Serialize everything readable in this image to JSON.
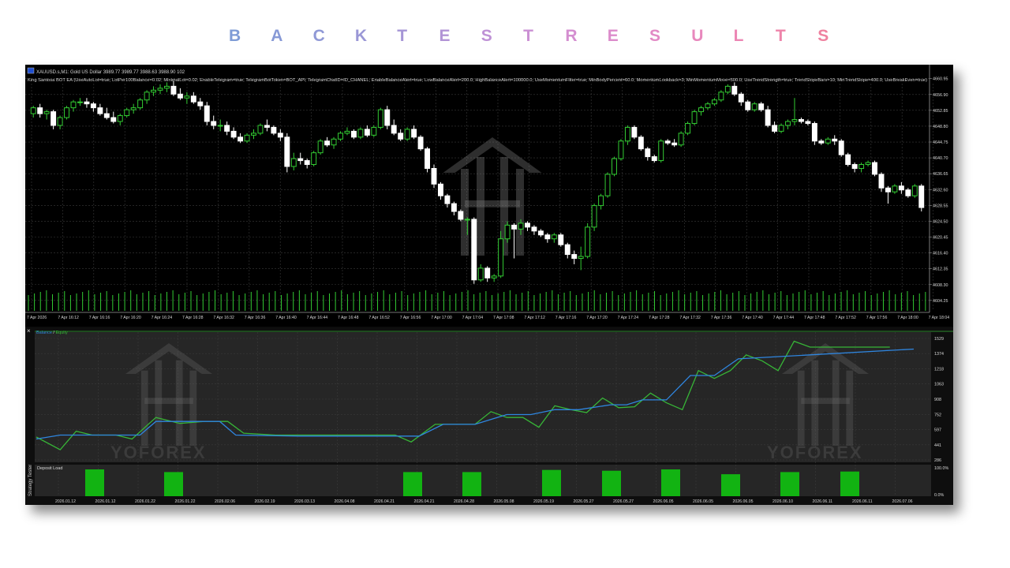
{
  "header": {
    "title_letters": [
      "B",
      "A",
      "C",
      "K",
      "T",
      "E",
      "S",
      "T",
      "R",
      "E",
      "S",
      "U",
      "L",
      "T",
      "S"
    ],
    "title_colors": [
      "#7f9cd6",
      "#8799d6",
      "#9099d6",
      "#9a97d6",
      "#a595d6",
      "#b294d6",
      "#bf92d6",
      "#cb90d4",
      "#d48ed0",
      "#dc8ccb",
      "#e28ac5",
      "#e888bd",
      "#ec86b4",
      "#ee84aa",
      "#ef82a0"
    ]
  },
  "price_chart": {
    "symbol_line": "XAUUSD.s,M1:  Gold US Dollar  3989.77 3989.77 3988.63 3988.90  102",
    "ea_params": "King Santosa BOT EA (UseAutoLot=true; LotPer100Balance=0.02; MinimalLot=0.02; EnableTelegram=true; TelegramBotToken=BOT_API; TelegramChatID=ID_CHANEL; EnableBalanceAlert=true; LowBalanceAlert=200.0; HighBalanceAlert=100000.0; UseMomentumFilter=true; MinBodyPercent=60.0; MomentumLookback=3; MinMomentumMove=500.0; UseTrendStrength=true; TrendSlopeBars=10; MinTrendSlope=400.0; UseBreakEven=true)",
    "price_axis": [
      "4660.95",
      "4656.90",
      "4652.85",
      "4648.80",
      "4644.75",
      "4640.70",
      "4636.65",
      "4632.60",
      "4628.55",
      "4624.50",
      "4620.45",
      "4616.40",
      "4612.35",
      "4608.30",
      "4604.25"
    ],
    "time_axis": [
      "7 Apr 2026",
      "7 Apr 16:12",
      "7 Apr 16:16",
      "7 Apr 16:20",
      "7 Apr 16:24",
      "7 Apr 16:28",
      "7 Apr 16:32",
      "7 Apr 16:36",
      "7 Apr 16:40",
      "7 Apr 16:44",
      "7 Apr 16:48",
      "7 Apr 16:52",
      "7 Apr 16:56",
      "7 Apr 17:00",
      "7 Apr 17:04",
      "7 Apr 17:08",
      "7 Apr 17:12",
      "7 Apr 17:16",
      "7 Apr 17:20",
      "7 Apr 17:24",
      "7 Apr 17:28",
      "7 Apr 17:32",
      "7 Apr 17:36",
      "7 Apr 17:40",
      "7 Apr 17:44",
      "7 Apr 17:48",
      "7 Apr 17:52",
      "7 Apr 17:56",
      "7 Apr 18:00",
      "7 Apr 18:04"
    ],
    "watermark": "yoforex-logo"
  },
  "tester": {
    "close_glyph": "×",
    "legend_balance": "Balance",
    "legend_sep": " / ",
    "legend_equity": "Equity",
    "side_label": "Strategy Tester",
    "deposit_label": "Deposit Load",
    "watermark_text": "YOFOREX",
    "deposit_axis": [
      "100.0%",
      "0.0%"
    ],
    "date_axis": [
      "2026.01.12",
      "2026.01.12",
      "2026.01.22",
      "2026.01.22",
      "2026.02.06",
      "2026.02.19",
      "2026.03.13",
      "2026.04.08",
      "2026.04.21",
      "2026.04.21",
      "2026.04.28",
      "2026.05.08",
      "2026.05.19",
      "2026.05.27",
      "2026.05.27",
      "2026.06.05",
      "2026.06.05",
      "2026.06.05",
      "2026.06.10",
      "2026.06.11",
      "2026.06.11",
      "2026.07.06"
    ]
  },
  "colors": {
    "bull": "#33cc33",
    "bear": "#ffffff",
    "balance": "#2f86e0",
    "equity": "#37b537",
    "deposit": "#12b312",
    "grid": "#3a3a3a",
    "text": "#d8d8d8"
  },
  "chart_data": [
    {
      "type": "candlestick",
      "title": "XAUUSD.s,M1:  Gold US Dollar",
      "y_axis_range": [
        4602.0,
        4662.5
      ],
      "ohlc": [
        [
          4652.0,
          4654.0,
          4651.0,
          4653.5
        ],
        [
          4653.5,
          4654.5,
          4651.0,
          4652.0
        ],
        [
          4652.0,
          4653.0,
          4650.5,
          4652.5
        ],
        [
          4652.5,
          4653.0,
          4648.0,
          4649.0
        ],
        [
          4649.0,
          4651.5,
          4648.0,
          4651.0
        ],
        [
          4651.0,
          4654.0,
          4650.5,
          4653.5
        ],
        [
          4653.5,
          4655.5,
          4652.5,
          4655.0
        ],
        [
          4655.0,
          4656.0,
          4654.0,
          4655.0
        ],
        [
          4655.0,
          4656.0,
          4653.5,
          4654.5
        ],
        [
          4654.5,
          4655.0,
          4652.5,
          4653.5
        ],
        [
          4653.5,
          4654.5,
          4651.5,
          4652.0
        ],
        [
          4652.0,
          4653.5,
          4650.5,
          4651.0
        ],
        [
          4651.0,
          4652.5,
          4649.5,
          4650.0
        ],
        [
          4650.0,
          4652.0,
          4649.0,
          4651.5
        ],
        [
          4651.5,
          4653.5,
          4651.0,
          4653.0
        ],
        [
          4653.0,
          4654.5,
          4652.0,
          4653.5
        ],
        [
          4653.5,
          4656.0,
          4653.0,
          4655.5
        ],
        [
          4655.5,
          4658.0,
          4654.5,
          4657.5
        ],
        [
          4657.5,
          4659.0,
          4656.5,
          4658.0
        ],
        [
          4658.0,
          4659.5,
          4657.0,
          4658.5
        ],
        [
          4658.5,
          4660.0,
          4657.5,
          4659.0
        ],
        [
          4659.0,
          4660.5,
          4656.5,
          4657.0
        ],
        [
          4657.0,
          4658.5,
          4655.5,
          4656.0
        ],
        [
          4656.0,
          4657.5,
          4654.5,
          4656.5
        ],
        [
          4656.5,
          4657.5,
          4654.5,
          4655.0
        ],
        [
          4655.0,
          4656.0,
          4653.0,
          4654.0
        ],
        [
          4654.0,
          4655.0,
          4649.0,
          4650.0
        ],
        [
          4650.0,
          4651.5,
          4648.0,
          4649.0
        ],
        [
          4649.0,
          4650.5,
          4647.5,
          4649.0
        ],
        [
          4649.0,
          4650.0,
          4646.5,
          4647.5
        ],
        [
          4647.5,
          4648.5,
          4645.5,
          4646.0
        ],
        [
          4646.0,
          4647.0,
          4644.5,
          4645.0
        ],
        [
          4645.0,
          4647.0,
          4644.5,
          4646.5
        ],
        [
          4646.5,
          4648.0,
          4645.5,
          4647.0
        ],
        [
          4647.0,
          4649.5,
          4646.5,
          4649.0
        ],
        [
          4649.0,
          4650.5,
          4647.5,
          4648.5
        ],
        [
          4648.5,
          4649.0,
          4646.5,
          4647.0
        ],
        [
          4647.0,
          4648.0,
          4645.0,
          4646.0
        ],
        [
          4646.0,
          4647.0,
          4637.0,
          4638.5
        ],
        [
          4638.5,
          4642.0,
          4637.5,
          4640.5
        ],
        [
          4640.5,
          4642.0,
          4639.0,
          4640.0
        ],
        [
          4640.0,
          4640.5,
          4638.0,
          4639.0
        ],
        [
          4639.0,
          4642.5,
          4638.5,
          4642.0
        ],
        [
          4642.0,
          4645.5,
          4641.5,
          4645.0
        ],
        [
          4645.0,
          4646.0,
          4643.5,
          4644.0
        ],
        [
          4644.0,
          4646.0,
          4643.0,
          4645.5
        ],
        [
          4645.5,
          4647.5,
          4645.0,
          4647.0
        ],
        [
          4647.0,
          4648.5,
          4646.5,
          4647.5
        ],
        [
          4647.5,
          4648.0,
          4645.5,
          4646.0
        ],
        [
          4646.0,
          4648.5,
          4645.5,
          4648.0
        ],
        [
          4648.0,
          4649.0,
          4646.0,
          4646.5
        ],
        [
          4646.5,
          4649.0,
          4646.0,
          4648.5
        ],
        [
          4648.5,
          4653.5,
          4648.0,
          4653.0
        ],
        [
          4653.0,
          4654.0,
          4648.0,
          4649.0
        ],
        [
          4649.0,
          4650.5,
          4646.5,
          4647.0
        ],
        [
          4647.0,
          4648.0,
          4645.0,
          4645.5
        ],
        [
          4645.5,
          4648.5,
          4645.0,
          4648.0
        ],
        [
          4648.0,
          4649.0,
          4645.5,
          4646.0
        ],
        [
          4646.0,
          4646.5,
          4642.5,
          4643.0
        ],
        [
          4643.0,
          4643.5,
          4637.0,
          4638.0
        ],
        [
          4638.0,
          4639.0,
          4633.0,
          4634.0
        ],
        [
          4634.0,
          4634.5,
          4630.0,
          4631.0
        ],
        [
          4631.0,
          4631.5,
          4628.0,
          4629.0
        ],
        [
          4629.0,
          4629.5,
          4626.0,
          4627.0
        ],
        [
          4627.0,
          4627.5,
          4624.5,
          4625.0
        ],
        [
          4625.0,
          4625.5,
          4621.0,
          4625.0
        ],
        [
          4625.0,
          4625.5,
          4608.5,
          4609.5
        ],
        [
          4609.5,
          4613.5,
          4609.0,
          4612.5
        ],
        [
          4612.5,
          4613.0,
          4609.0,
          4610.0
        ],
        [
          4610.0,
          4611.0,
          4609.0,
          4610.5
        ],
        [
          4610.5,
          4622.0,
          4610.0,
          4620.0
        ],
        [
          4620.0,
          4624.5,
          4619.0,
          4623.5
        ],
        [
          4623.5,
          4624.0,
          4615.0,
          4622.5
        ],
        [
          4622.5,
          4625.0,
          4621.0,
          4624.0
        ],
        [
          4624.0,
          4624.5,
          4622.0,
          4623.0
        ],
        [
          4623.0,
          4623.5,
          4621.0,
          4622.0
        ],
        [
          4622.0,
          4622.5,
          4620.5,
          4621.0
        ],
        [
          4621.0,
          4621.5,
          4619.0,
          4620.0
        ],
        [
          4620.0,
          4621.5,
          4619.0,
          4621.0
        ],
        [
          4621.0,
          4621.5,
          4618.0,
          4618.5
        ],
        [
          4618.5,
          4619.0,
          4615.0,
          4616.0
        ],
        [
          4616.0,
          4617.0,
          4613.5,
          4615.0
        ],
        [
          4615.0,
          4618.0,
          4612.0,
          4615.5
        ],
        [
          4615.5,
          4624.0,
          4615.0,
          4623.0
        ],
        [
          4623.0,
          4629.0,
          4622.0,
          4628.5
        ],
        [
          4628.5,
          4631.5,
          4627.5,
          4631.0
        ],
        [
          4631.0,
          4637.0,
          4630.5,
          4636.5
        ],
        [
          4636.5,
          4641.0,
          4636.0,
          4640.5
        ],
        [
          4640.5,
          4645.5,
          4640.0,
          4645.0
        ],
        [
          4645.0,
          4649.0,
          4644.0,
          4648.5
        ],
        [
          4648.5,
          4649.0,
          4645.5,
          4646.0
        ],
        [
          4646.0,
          4646.5,
          4642.5,
          4643.0
        ],
        [
          4643.0,
          4643.5,
          4640.0,
          4641.0
        ],
        [
          4641.0,
          4641.5,
          4639.5,
          4640.0
        ],
        [
          4640.0,
          4645.5,
          4639.5,
          4645.0
        ],
        [
          4645.0,
          4645.5,
          4644.0,
          4644.5
        ],
        [
          4644.5,
          4645.5,
          4643.5,
          4644.0
        ],
        [
          4644.0,
          4647.5,
          4643.5,
          4647.0
        ],
        [
          4647.0,
          4650.0,
          4646.5,
          4649.5
        ],
        [
          4649.5,
          4653.0,
          4649.0,
          4652.5
        ],
        [
          4652.5,
          4654.0,
          4651.5,
          4653.5
        ],
        [
          4653.5,
          4655.0,
          4653.0,
          4654.5
        ],
        [
          4654.5,
          4656.0,
          4654.0,
          4655.5
        ],
        [
          4655.5,
          4658.0,
          4655.0,
          4657.5
        ],
        [
          4657.5,
          4659.5,
          4657.0,
          4659.0
        ],
        [
          4659.0,
          4660.0,
          4656.5,
          4657.0
        ],
        [
          4657.0,
          4657.5,
          4654.0,
          4655.0
        ],
        [
          4655.0,
          4655.5,
          4652.5,
          4653.0
        ],
        [
          4653.0,
          4655.0,
          4652.5,
          4654.5
        ],
        [
          4654.5,
          4655.0,
          4652.5,
          4653.0
        ],
        [
          4653.0,
          4654.0,
          4648.5,
          4649.0
        ],
        [
          4649.0,
          4650.0,
          4647.0,
          4647.5
        ],
        [
          4647.5,
          4649.5,
          4647.0,
          4649.0
        ],
        [
          4649.0,
          4650.5,
          4648.0,
          4650.0
        ],
        [
          4650.0,
          4656.0,
          4649.0,
          4650.5
        ],
        [
          4650.5,
          4651.0,
          4649.5,
          4650.0
        ],
        [
          4650.0,
          4650.5,
          4649.0,
          4649.5
        ],
        [
          4649.5,
          4650.0,
          4644.0,
          4645.0
        ],
        [
          4645.0,
          4645.5,
          4644.0,
          4644.5
        ],
        [
          4644.5,
          4646.0,
          4644.0,
          4645.5
        ],
        [
          4645.5,
          4646.5,
          4644.0,
          4645.0
        ],
        [
          4645.0,
          4645.5,
          4641.0,
          4641.5
        ],
        [
          4641.5,
          4642.0,
          4638.5,
          4639.0
        ],
        [
          4639.0,
          4639.5,
          4637.0,
          4638.0
        ],
        [
          4638.0,
          4639.5,
          4637.0,
          4639.0
        ],
        [
          4639.0,
          4640.0,
          4638.5,
          4639.5
        ],
        [
          4639.5,
          4640.0,
          4636.0,
          4636.5
        ],
        [
          4636.5,
          4637.0,
          4632.0,
          4633.0
        ],
        [
          4633.0,
          4633.5,
          4629.0,
          4632.0
        ],
        [
          4632.0,
          4634.0,
          4631.5,
          4633.5
        ],
        [
          4633.5,
          4634.5,
          4631.5,
          4632.5
        ],
        [
          4632.5,
          4633.0,
          4630.5,
          4631.0
        ],
        [
          4631.0,
          4634.0,
          4630.5,
          4633.5
        ],
        [
          4633.5,
          4634.0,
          4627.0,
          4628.0
        ]
      ],
      "volume": "uniform green tick volume bars along the bottom"
    },
    {
      "type": "line",
      "title": "Balance / Equity",
      "y_ticks": [
        1529,
        1374,
        1218,
        1063,
        908,
        752,
        597,
        441,
        286
      ],
      "y_axis_range": [
        286,
        1529
      ],
      "series": [
        {
          "name": "Balance",
          "x": [
            0,
            3,
            5,
            10,
            13,
            15,
            17,
            20,
            23,
            25,
            33,
            37,
            40,
            42,
            45,
            48,
            51,
            55,
            59,
            62,
            65,
            68,
            72,
            74,
            76,
            79,
            82,
            85,
            88,
            110
          ],
          "values": [
            500,
            540,
            540,
            540,
            540,
            680,
            680,
            680,
            680,
            540,
            530,
            530,
            530,
            530,
            530,
            530,
            650,
            650,
            750,
            750,
            800,
            800,
            850,
            850,
            900,
            900,
            1150,
            1150,
            1320,
            1420
          ]
        },
        {
          "name": "Equity",
          "x": [
            0,
            3,
            5,
            7,
            10,
            12,
            15,
            18,
            21,
            24,
            26,
            30,
            33,
            37,
            40,
            41,
            43,
            45,
            47,
            50,
            53,
            55,
            57,
            59,
            61,
            63,
            65,
            67,
            69,
            71,
            73,
            75,
            77,
            79,
            81,
            83,
            85,
            87,
            89,
            91,
            93,
            95,
            97,
            99,
            101,
            103,
            105,
            107
          ],
          "values": [
            520,
            390,
            580,
            540,
            540,
            500,
            720,
            660,
            680,
            680,
            560,
            540,
            540,
            540,
            540,
            540,
            540,
            540,
            470,
            650,
            650,
            650,
            780,
            720,
            720,
            620,
            840,
            800,
            770,
            920,
            820,
            830,
            970,
            870,
            800,
            1200,
            1120,
            1200,
            1360,
            1300,
            1200,
            1500,
            1440,
            1440,
            1440,
            1440,
            1440,
            1440
          ]
        }
      ]
    },
    {
      "type": "bar",
      "title": "Deposit Load",
      "y_ticks": [
        "100.0%",
        "0.0%"
      ],
      "categories": [
        "2026.01.12",
        "2026.01.22",
        "2026.04.21",
        "2026.04.28",
        "2026.05.19",
        "2026.05.27",
        "2026.06.05",
        "2026.06.05",
        "2026.06.10",
        "2026.06.11"
      ],
      "values": [
        100,
        90,
        90,
        90,
        98,
        95,
        100,
        82,
        90,
        92
      ],
      "unit": "%"
    }
  ]
}
